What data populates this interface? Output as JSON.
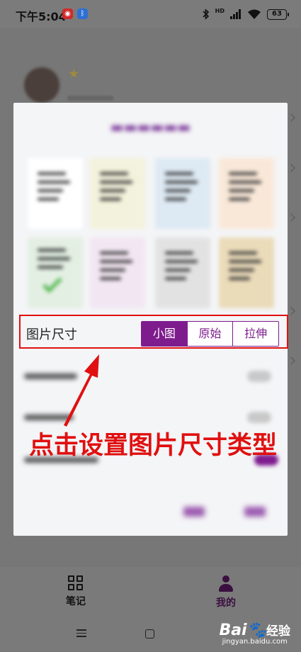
{
  "status_bar": {
    "time": "下午5:04",
    "battery": "63"
  },
  "dialog": {
    "image_size": {
      "label": "图片尺寸",
      "options": [
        "小图",
        "原始",
        "拉伸"
      ],
      "selected": "小图"
    }
  },
  "annotation": {
    "text": "点击设置图片尺寸类型"
  },
  "bottom_nav": {
    "items": [
      {
        "label": "笔记",
        "icon": "grid-icon",
        "active": false
      },
      {
        "label": "我的",
        "icon": "person-icon",
        "active": true
      }
    ]
  },
  "watermark": {
    "main": "Bai",
    "mark": "经验",
    "sub": "jingyan.baidu.com"
  },
  "colors": {
    "accent": "#7e1c8e",
    "highlight": "#e01010"
  }
}
